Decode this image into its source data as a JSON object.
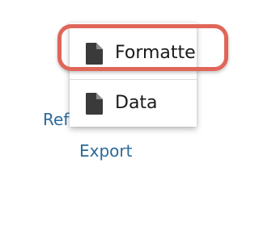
{
  "background_links": {
    "refresh_label": "Refr",
    "export_label": "Export"
  },
  "dropdown_menu": {
    "items": [
      {
        "label": "Formatted",
        "icon": "file-icon"
      },
      {
        "label": "Data",
        "icon": "file-icon"
      }
    ]
  },
  "colors": {
    "link": "#2b6a99",
    "highlight_ring": "#e0665a",
    "icon": "#3a3a3a"
  }
}
